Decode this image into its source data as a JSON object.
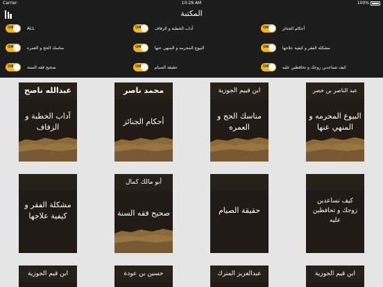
{
  "status": {
    "carrier": "Carrier",
    "time": "10:28 AM",
    "battery": "100%"
  },
  "nav": {
    "title": "المكتبة"
  },
  "colors": {
    "accent": "#f2b520",
    "cover": "#221a14",
    "grid_bg": "#e5e5e5",
    "bar_bg": "#1c1c1c"
  },
  "filters": [
    {
      "label": "ALL",
      "state": "ON"
    },
    {
      "label": "آداب الخطبة و الزفاف",
      "state": "ON"
    },
    {
      "label": "أحكام الجنائز",
      "state": "ON"
    },
    {
      "label": "مناسك الحج و العمره",
      "state": "ON"
    },
    {
      "label": "البيوع المحرمه و المنهي عنها",
      "state": "ON"
    },
    {
      "label": "مشكلة الفقر و كيفية علاجها",
      "state": "ON"
    },
    {
      "label": "صحيح فقه السنة",
      "state": "ON"
    },
    {
      "label": "حقيقة الصيام",
      "state": "ON"
    },
    {
      "label": "كيف تساعدين زوجك و تحافظين عليه",
      "state": "ON"
    }
  ],
  "books": [
    {
      "author": "عبدالله ناصح",
      "title": "آداب الخطبة و الزفاف"
    },
    {
      "author": "محمد ناصر",
      "title": "أحكام الجنائز"
    },
    {
      "author": "ابن قييم الجوزية",
      "title": "مناسك الحج و العمره"
    },
    {
      "author": "عبد الناصر بن خضر",
      "title": "البيوع المحرمه و المنهي عنها"
    },
    {
      "author": "",
      "title": "مشكلة الفقر و كيفية علاجها"
    },
    {
      "author": "أبو مالك كمال",
      "title": "صحيح فقه السنة"
    },
    {
      "author": "",
      "title": "حقيقة الصيام"
    },
    {
      "author": "",
      "title": "كيف تساعدين زوجك و تحافظين عليه"
    },
    {
      "author": "ابن قيم الجوزية",
      "title": ""
    },
    {
      "author": "حسين بن عودة",
      "title": ""
    },
    {
      "author": "عبدالعزيز المترك",
      "title": ""
    },
    {
      "author": "ابن قيم الجوزية",
      "title": ""
    }
  ]
}
